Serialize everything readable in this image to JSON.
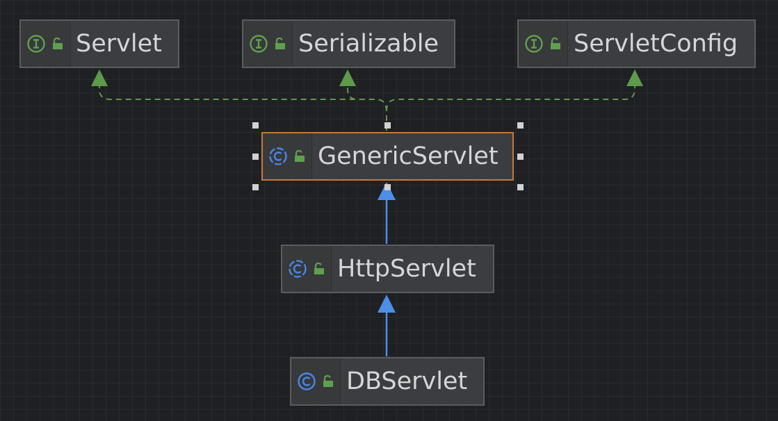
{
  "diagram": {
    "nodes": [
      {
        "id": "servlet",
        "kind": "interface",
        "name": "Servlet"
      },
      {
        "id": "serializable",
        "kind": "interface",
        "name": "Serializable"
      },
      {
        "id": "servletconfig",
        "kind": "interface",
        "name": "ServletConfig"
      },
      {
        "id": "genericservlet",
        "kind": "class",
        "name": "GenericServlet",
        "selected": true
      },
      {
        "id": "httpservlet",
        "kind": "class",
        "name": "HttpServlet"
      },
      {
        "id": "dbservlet",
        "kind": "class",
        "name": "DBServlet"
      }
    ],
    "edges": [
      {
        "from": "genericservlet",
        "to": "servlet",
        "type": "implements"
      },
      {
        "from": "genericservlet",
        "to": "serializable",
        "type": "implements"
      },
      {
        "from": "genericservlet",
        "to": "servletconfig",
        "type": "implements"
      },
      {
        "from": "httpservlet",
        "to": "genericservlet",
        "type": "extends"
      },
      {
        "from": "dbservlet",
        "to": "httpservlet",
        "type": "extends"
      }
    ]
  },
  "icons": {
    "interface": "interface-icon",
    "class": "class-icon",
    "visibility": "public-lock-icon"
  },
  "colors": {
    "background": "#1f2023",
    "node_fill": "#3c3d40",
    "node_border": "#5a5c5f",
    "selected_border": "#c37a3a",
    "interface_green": "#5fa04e",
    "class_blue": "#4a86e8",
    "implements_line": "#5e9a4c",
    "extends_line": "#4d8ee6",
    "label_text": "#d4d6d8"
  }
}
